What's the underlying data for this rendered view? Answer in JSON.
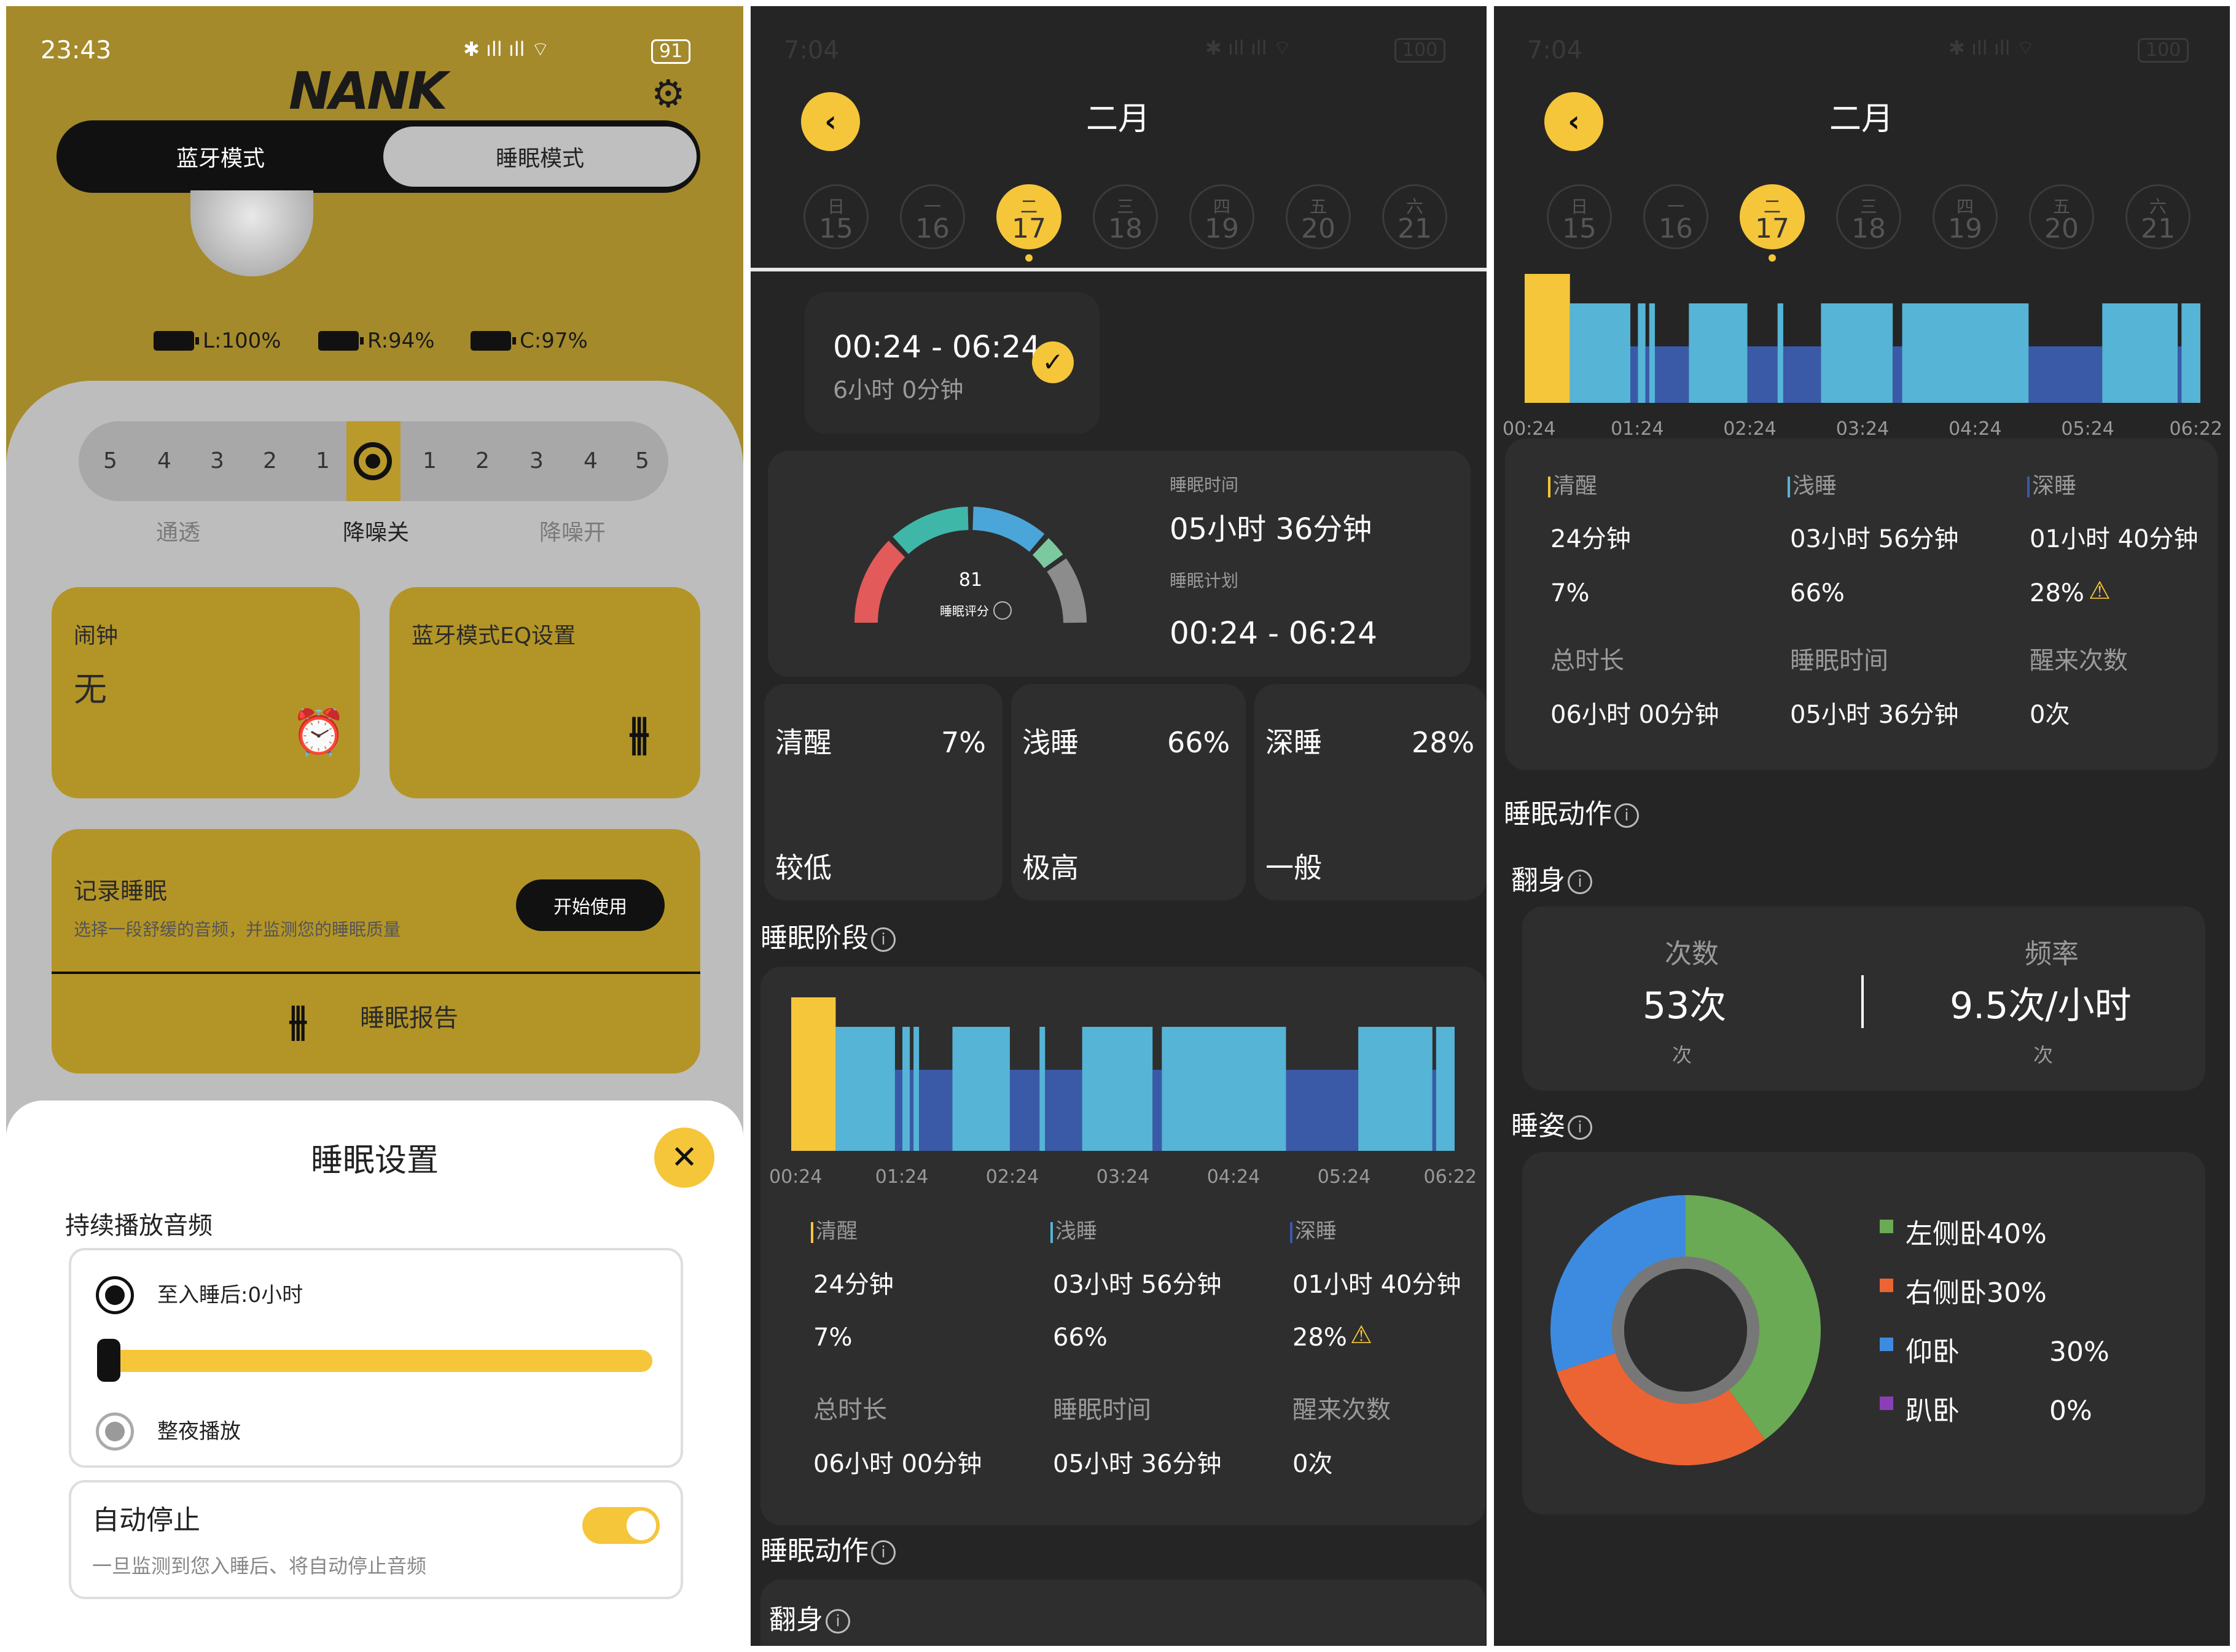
{
  "panel1": {
    "status": {
      "time": "23:43",
      "battery": "91"
    },
    "brand": "NANK",
    "modes": {
      "bluetooth": "蓝牙模式",
      "sleep": "睡眠模式"
    },
    "battery": {
      "left": "L:100%",
      "right": "R:94%",
      "case": "C:97%"
    },
    "anc": {
      "levels_left": [
        "5",
        "4",
        "3",
        "2",
        "1"
      ],
      "levels_right": [
        "1",
        "2",
        "3",
        "4",
        "5"
      ],
      "labels": {
        "transparency": "通透",
        "off": "降噪关",
        "on": "降噪开"
      }
    },
    "alarm": {
      "title": "闹钟",
      "value": "无"
    },
    "eq": {
      "title": "蓝牙模式EQ设置"
    },
    "record": {
      "title": "记录睡眠",
      "desc": "选择一段舒缓的音频，并监测您的睡眠质量",
      "start": "开始使用",
      "report": "睡眠报告"
    },
    "sheet": {
      "title": "睡眠设置",
      "section": "持续播放音频",
      "option1": "至入睡后:0小时",
      "option2": "整夜播放",
      "slider_value": 0,
      "autostop_title": "自动停止",
      "autostop_desc": "一旦监测到您入睡后、将自动停止音频",
      "autostop_on": true
    }
  },
  "calendar": {
    "month": "二月",
    "days": [
      {
        "w": "日",
        "n": "15"
      },
      {
        "w": "一",
        "n": "16"
      },
      {
        "w": "二",
        "n": "17"
      },
      {
        "w": "三",
        "n": "18"
      },
      {
        "w": "四",
        "n": "19"
      },
      {
        "w": "五",
        "n": "20"
      },
      {
        "w": "六",
        "n": "21"
      }
    ],
    "selected_index": 2
  },
  "panel2": {
    "status_time": "7:04",
    "status_battery": "100",
    "session": {
      "range": "00:24 - 06:24",
      "duration": "6小时 0分钟"
    },
    "score": {
      "value": "81",
      "label": "睡眠评分"
    },
    "sleep_time_label": "睡眠时间",
    "sleep_time": "05小时 36分钟",
    "plan_label": "睡眠计划",
    "plan": "00:24 - 06:24",
    "stages": [
      {
        "name": "清醒",
        "pct": "7%",
        "level": "较低"
      },
      {
        "name": "浅睡",
        "pct": "66%",
        "level": "极高"
      },
      {
        "name": "深睡",
        "pct": "28%",
        "level": "一般"
      }
    ],
    "stage_section": "睡眠阶段",
    "motion_section": "睡眠动作",
    "turn_section": "翻身"
  },
  "panel3": {
    "status_time": "7:04",
    "status_battery": "100",
    "motion_section": "睡眠动作",
    "turn_section": "翻身",
    "count_label": "次数",
    "count_value": "53次",
    "count_unit": "次",
    "freq_label": "频率",
    "freq_value": "9.5次/小时",
    "freq_unit": "次",
    "posture_section": "睡姿"
  },
  "summary": {
    "awake": {
      "label": "清醒",
      "time": "24分钟",
      "pct": "7%"
    },
    "light": {
      "label": "浅睡",
      "time": "03小时 56分钟",
      "pct": "66%"
    },
    "deep": {
      "label": "深睡",
      "time": "01小时 40分钟",
      "pct": "28%"
    },
    "total_label": "总时长",
    "total": "06小时 00分钟",
    "sleep_label": "睡眠时间",
    "sleep": "05小时 36分钟",
    "wake_label": "醒来次数",
    "wake": "0次"
  },
  "colors": {
    "accent": "#f5c63a",
    "awake": "#f5c63a",
    "light": "#56b4d6",
    "deep": "#3a5aa8",
    "left_side": "#6aaa55",
    "right_side": "#ec6434",
    "back": "#3d8be0",
    "prone": "#8a3fb8"
  },
  "chart_data": [
    {
      "type": "bar",
      "chart": "sleep-stage-timeline",
      "x_ticks": [
        "00:24",
        "01:24",
        "02:24",
        "03:24",
        "04:24",
        "05:24",
        "06:22"
      ],
      "segments": [
        {
          "stage": "awake",
          "start": 0,
          "end": 24
        },
        {
          "stage": "light",
          "start": 24,
          "end": 56
        },
        {
          "stage": "deep",
          "start": 56,
          "end": 60
        },
        {
          "stage": "light",
          "start": 60,
          "end": 64
        },
        {
          "stage": "deep",
          "start": 64,
          "end": 66
        },
        {
          "stage": "light",
          "start": 66,
          "end": 69
        },
        {
          "stage": "deep",
          "start": 69,
          "end": 87
        },
        {
          "stage": "light",
          "start": 87,
          "end": 118
        },
        {
          "stage": "deep",
          "start": 118,
          "end": 134
        },
        {
          "stage": "light",
          "start": 134,
          "end": 137
        },
        {
          "stage": "deep",
          "start": 137,
          "end": 157
        },
        {
          "stage": "light",
          "start": 157,
          "end": 195
        },
        {
          "stage": "deep",
          "start": 195,
          "end": 200
        },
        {
          "stage": "light",
          "start": 200,
          "end": 267
        },
        {
          "stage": "deep",
          "start": 267,
          "end": 306
        },
        {
          "stage": "light",
          "start": 306,
          "end": 346
        },
        {
          "stage": "deep",
          "start": 346,
          "end": 348
        },
        {
          "stage": "light",
          "start": 348,
          "end": 358
        }
      ]
    },
    {
      "type": "pie",
      "chart": "sleep-posture",
      "categories": [
        "左侧卧",
        "右侧卧",
        "仰卧",
        "趴卧"
      ],
      "values": [
        40,
        30,
        30,
        0
      ],
      "labels": [
        "左侧卧40%",
        "右侧卧30%",
        "仰卧",
        "趴卧"
      ],
      "pct_labels": [
        "",
        "",
        "30%",
        "0%"
      ]
    },
    {
      "type": "pie",
      "chart": "sleep-score-gauge",
      "value": 81
    }
  ]
}
